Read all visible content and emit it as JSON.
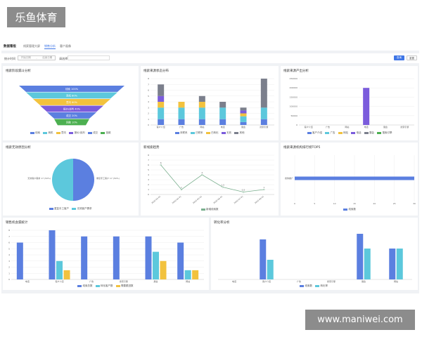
{
  "watermark": {
    "logo_text": "乐鱼体育",
    "url_text": "www.maniwei.com"
  },
  "nav": {
    "brand": "数据看板",
    "tabs": [
      "线索管理大屏",
      "销售分析",
      "客户画像"
    ],
    "active_tab": 1
  },
  "filter": {
    "date_label": "统计时间",
    "date_start": "开始日期",
    "date_sep": "-",
    "date_end": "结束日期",
    "region_label": "请选择",
    "region_placeholder": "",
    "query_button": "查询",
    "reset_button": "重置"
  },
  "colors": {
    "blue": "#5b7fe0",
    "teal": "#5cc8dc",
    "yellow": "#f2c23e",
    "purple": "#7b5cdc",
    "gray": "#7b7f8c",
    "green": "#4caf50",
    "line": "#7aaf8e"
  },
  "panels": {
    "funnel": {
      "title": "线索阶段漏斗分析"
    },
    "source": {
      "title": "线索来源状态分布"
    },
    "channel": {
      "title": "线索来源产出分析"
    },
    "type": {
      "title": "线索无效原因分析"
    },
    "trend": {
      "title": "新线索趋势"
    },
    "top5": {
      "title": "线索来源机构排行榜TOP5"
    },
    "follow": {
      "title": "销售机会漏统计"
    },
    "convert": {
      "title": "转化率分析"
    }
  },
  "chart_data": [
    {
      "type": "funnel",
      "stages": [
        {
          "label": "线索",
          "value": "100%"
        },
        {
          "label": "商机",
          "value": "80%"
        },
        {
          "label": "意向",
          "value": "60%"
        },
        {
          "label": "报价/谈判",
          "value": "40%"
        },
        {
          "label": "成交",
          "value": "20%"
        },
        {
          "label": "回款",
          "value": "10%"
        }
      ],
      "legend": [
        "线索",
        "商机",
        "意向",
        "报价/谈判",
        "成交",
        "回款"
      ]
    },
    {
      "type": "bar",
      "stacked": true,
      "categories": [
        "客户介绍",
        "广告",
        "网站",
        "电话",
        "展会",
        "搜索引擎"
      ],
      "series": [
        {
          "name": "未联系",
          "values": [
            1,
            1,
            1,
            1,
            0.5,
            1
          ]
        },
        {
          "name": "已联系",
          "values": [
            2,
            2,
            2,
            2,
            1,
            2
          ]
        },
        {
          "name": "已转化",
          "values": [
            1,
            1,
            1,
            0,
            0.5,
            0
          ]
        },
        {
          "name": "无效",
          "values": [
            1,
            0,
            0,
            0,
            0.5,
            0
          ]
        },
        {
          "name": "其他",
          "values": [
            2,
            0,
            1,
            1,
            0.5,
            5
          ]
        }
      ],
      "ylim": [
        0,
        8
      ],
      "yticks": [
        0,
        1,
        2,
        3,
        4,
        5,
        6,
        7,
        8
      ]
    },
    {
      "type": "bar",
      "categories": [
        "客户介绍",
        "广告",
        "网站",
        "电话",
        "展会",
        "搜索引擎"
      ],
      "values": [
        0,
        0,
        0,
        200000,
        0,
        0
      ],
      "ylim": [
        0,
        250000
      ],
      "yticks": [
        "0",
        "50000",
        "100000",
        "150000",
        "200000",
        "250000"
      ],
      "legend": [
        "客户介绍",
        "广告",
        "网站",
        "电话",
        "展会",
        "搜索引擎"
      ]
    },
    {
      "type": "pie",
      "slices": [
        {
          "label": "无效客户需求 17 (50%)",
          "value": 50
        },
        {
          "label": "重复手工客户 17 (50%)",
          "value": 50
        }
      ],
      "legend": [
        "重复手工客户",
        "无效客户需求"
      ]
    },
    {
      "type": "line",
      "x": [
        "2020-03-01",
        "2020-04-01",
        "2020-05-01",
        "2020-06-01",
        "2020-07-01",
        "2020-08-01"
      ],
      "values": [
        6,
        1,
        4,
        1.5,
        0.5,
        1
      ],
      "ylim": [
        0,
        8
      ],
      "yticks": [
        0,
        1,
        2,
        3,
        4,
        5,
        6,
        7,
        8
      ],
      "legend": [
        "新增线索数"
      ]
    },
    {
      "type": "bar",
      "orientation": "horizontal",
      "categories": [
        "搜狗推广"
      ],
      "values": [
        30
      ],
      "xlim": [
        0,
        30
      ],
      "xticks": [
        0,
        5,
        10,
        15,
        20,
        25,
        30
      ],
      "legend": [
        "线索数"
      ]
    },
    {
      "type": "bar",
      "categories": [
        "电话",
        "客户介绍",
        "广告",
        "搜索引擎",
        "展会",
        "网站"
      ],
      "series": [
        {
          "name": "线索总数",
          "values": [
            6,
            8,
            7,
            7,
            7,
            6
          ]
        },
        {
          "name": "转化客户数",
          "values": [
            0,
            3,
            0,
            0,
            4.5,
            1.5
          ]
        },
        {
          "name": "需要跟进数",
          "values": [
            0,
            1.5,
            0,
            0,
            3,
            1.5
          ]
        }
      ],
      "ylim": [
        0,
        8
      ],
      "yticks": [
        0,
        1,
        2,
        3,
        4,
        5,
        6,
        7,
        8
      ]
    },
    {
      "type": "bar",
      "categories": [
        "电话",
        "客户介绍",
        "广告",
        "搜索引擎",
        "展会",
        "网站"
      ],
      "series": [
        {
          "name": "线索数",
          "values": [
            0,
            57,
            0,
            0,
            65,
            44
          ]
        },
        {
          "name": "转化率",
          "values": [
            0,
            28,
            0,
            0,
            44,
            44
          ]
        }
      ],
      "ylim": [
        0,
        70
      ]
    }
  ]
}
